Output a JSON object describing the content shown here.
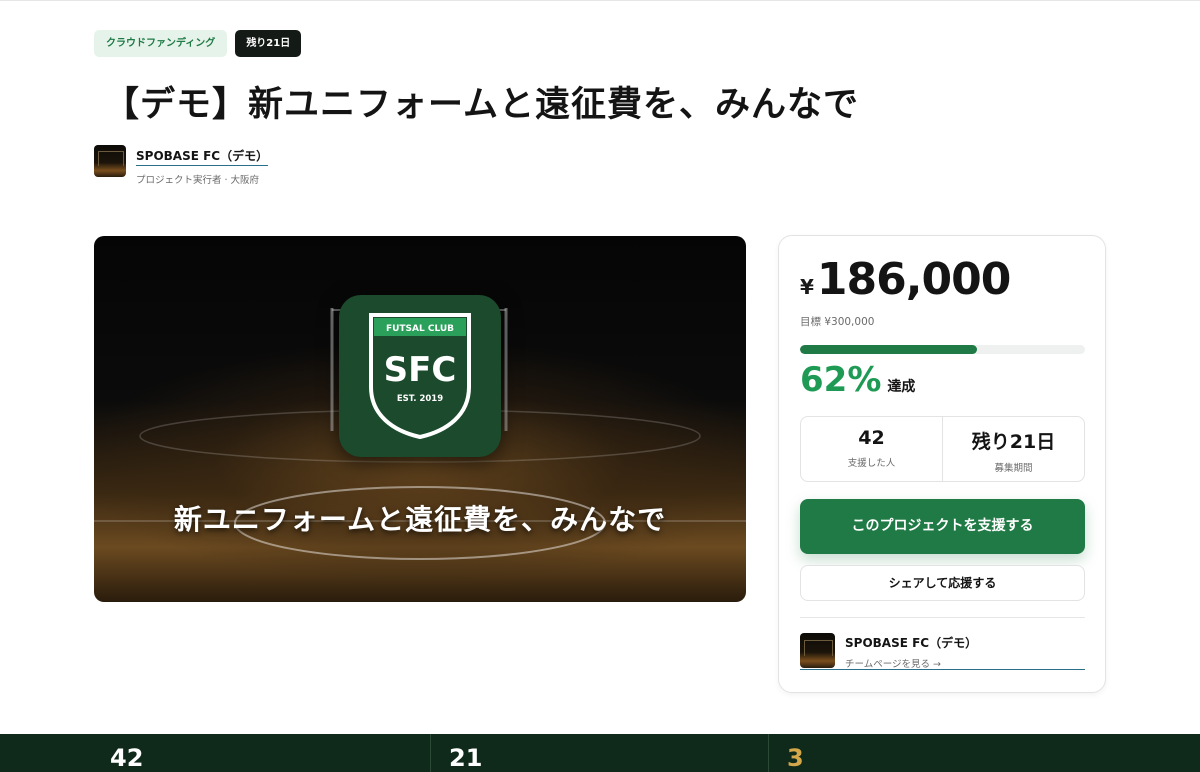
{
  "tags": {
    "category": "クラウドファンディング",
    "remaining": "残り21日"
  },
  "title": "【デモ】新ユニフォームと遠征費を、みんなで",
  "owner": {
    "name": "SPOBASE FC（デモ）",
    "subtitle": "プロジェクト実行者 · 大阪府"
  },
  "hero": {
    "crest_top": "FUTSAL CLUB",
    "crest_main": "SFC",
    "crest_est": "EST. 2019",
    "caption": "新ユニフォームと遠征費を、みんなで"
  },
  "funding": {
    "currency_symbol": "¥",
    "amount": "186,000",
    "goal_label": "目標 ¥300,000",
    "progress_fraction": 0.62,
    "percent": "62%",
    "percent_label": "達成",
    "supporters_value": "42",
    "supporters_label": "支援した人",
    "days_value": "残り21日",
    "days_label": "募集期間",
    "support_button": "このプロジェクトを支援する",
    "share_button": "シェアして応援する"
  },
  "team": {
    "name": "SPOBASE FC（デモ）",
    "link": "チームページを見る →"
  },
  "band": {
    "values": [
      "42",
      "21",
      "3"
    ]
  },
  "colors": {
    "brand_green": "#1f7a45",
    "percent_green": "#1f9a55",
    "band_dark": "#0f2a1a",
    "band_accent": "#d4a84a"
  }
}
